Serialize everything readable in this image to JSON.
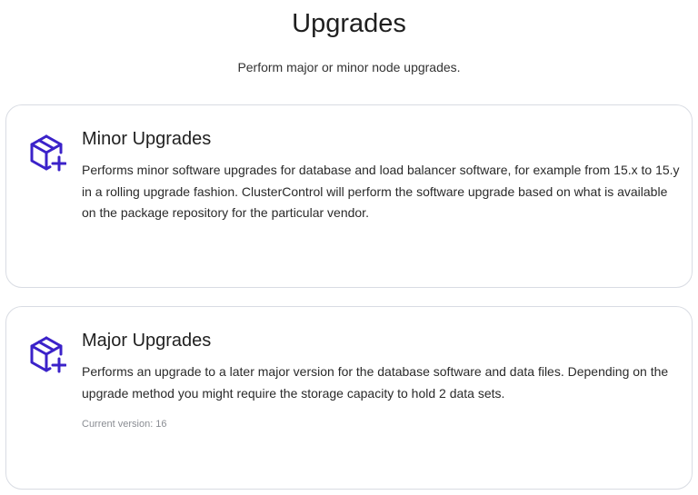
{
  "header": {
    "title": "Upgrades",
    "subtitle": "Perform major or minor node upgrades."
  },
  "cards": [
    {
      "title": "Minor Upgrades",
      "description": "Performs minor software upgrades for database and load balancer software, for example from 15.x to 15.y in a rolling upgrade fashion. ClusterControl will perform the software upgrade based on what is available on the package repository for the particular vendor.",
      "icon": "package-plus-icon"
    },
    {
      "title": "Major Upgrades",
      "description": "Performs an upgrade to a later major version for the database software and data files. Depending on the upgrade method you might require the storage capacity to hold 2 data sets.",
      "meta": "Current version: 16",
      "icon": "package-plus-icon"
    }
  ],
  "colors": {
    "icon": "#3b22c9",
    "card_border": "#d9dce3",
    "muted_text": "#8a8d93"
  }
}
